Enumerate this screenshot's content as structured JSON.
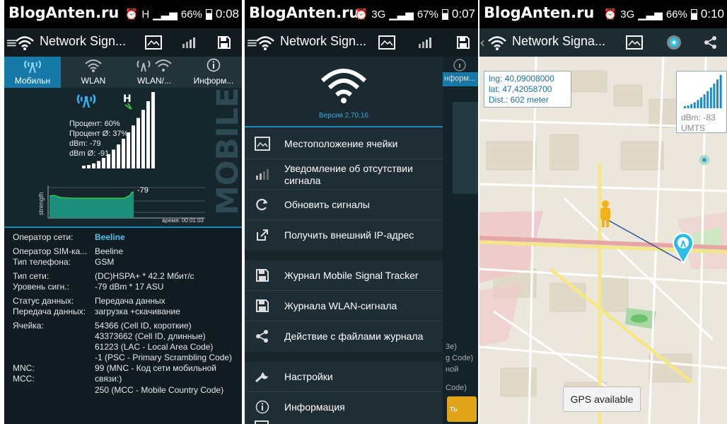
{
  "watermark": "BlogAnten.ru",
  "screen1": {
    "status": {
      "signal": "H",
      "battery": "66%",
      "time": "0:08"
    },
    "app_title": "Network Sign...",
    "tabs": [
      {
        "label": "Мобильн",
        "icon": "cell-tower-icon"
      },
      {
        "label": "WLAN",
        "icon": "wifi-icon"
      },
      {
        "label": "WLAN/...",
        "icon": "cell-wifi-icon"
      },
      {
        "label": "Информ...",
        "icon": "info-icon"
      }
    ],
    "network_type_badge": "H",
    "stats": {
      "percent": "Процент: 60%",
      "percent_avg": "Процент Ø: 37%",
      "dbm": "dBm: -79",
      "dbm_avg": "dBm Ø: -91"
    },
    "strength_percent": 60,
    "history": {
      "y_label": "strength",
      "current_value": "-79",
      "time_label": "время: 00:01:03"
    },
    "side_watermark": "MOBILE",
    "info_rows": [
      {
        "label": "Оператор сети:",
        "value": "Beeline"
      },
      {
        "label": "Оператор SIM-ка...",
        "value": "Beeline"
      },
      {
        "label": "Тип телефона:",
        "value": "GSM"
      },
      {
        "label": "Тип сети:",
        "value": "(DC)HSPA+ * 42.2 Мбит/с"
      },
      {
        "label": "Уровень сигн.:",
        "value": "-79 dBm * 17 ASU"
      },
      {
        "label": "Статус данных:",
        "value": "Передача данных"
      },
      {
        "label": "Передача данных:",
        "value": "загрузка +скачивание"
      },
      {
        "label": "Ячейка:",
        "value": "54366 (Cell ID, короткие)"
      },
      {
        "label": "",
        "value": "43373662 (Cell ID, длинные)"
      },
      {
        "label": "",
        "value": "61223 (LAC - Local Area Code)"
      },
      {
        "label": "",
        "value": "-1 (PSC - Primary Scrambling Code)"
      },
      {
        "label": "MNC:",
        "value": "99 (MNC - Код сети мобильной"
      },
      {
        "label": "MCC:",
        "value": "связи:)"
      },
      {
        "label": "",
        "value": "250 (MCC - Mobile Country Code)"
      }
    ]
  },
  "screen2": {
    "status": {
      "signal": "3G",
      "battery": "67%",
      "time": "0:07"
    },
    "app_title": "Network Sign...",
    "version": "Версия 2.70.16",
    "menu": [
      {
        "label": "Местоположение ячейки",
        "icon": "map-icon"
      },
      {
        "label": "Уведомление об отсутствии сигнала",
        "icon": "signal-bars-icon"
      },
      {
        "label": "Обновить сигналы",
        "icon": "refresh-icon"
      },
      {
        "label": "Получить внешний IP-адрес",
        "icon": "external-link-icon"
      },
      {
        "label": "Журнал Mobile Signal Tracker",
        "icon": "save-icon"
      },
      {
        "label": "Журнала WLAN-сигнала",
        "icon": "save-icon"
      },
      {
        "label": "Действие с файлами журнала",
        "icon": "share-icon"
      },
      {
        "label": "Настройки",
        "icon": "wrench-icon"
      },
      {
        "label": "Информация",
        "icon": "info-icon"
      }
    ],
    "background_peek": [
      "нформ...",
      "3e)",
      "g Code)",
      "ной",
      "Code)",
      "ть"
    ]
  },
  "screen3": {
    "status": {
      "signal": "3G",
      "battery": "66%",
      "time": "0:10"
    },
    "app_title": "Network Signa...",
    "coords": {
      "lng": "lng: 40,09008000",
      "lat": "lat: 47,42058700",
      "dist": "Dist.: 602 meter"
    },
    "signal_card": {
      "dbm": "dBm: -83",
      "type": "UMTS"
    },
    "gps_button": "GPS available"
  }
}
